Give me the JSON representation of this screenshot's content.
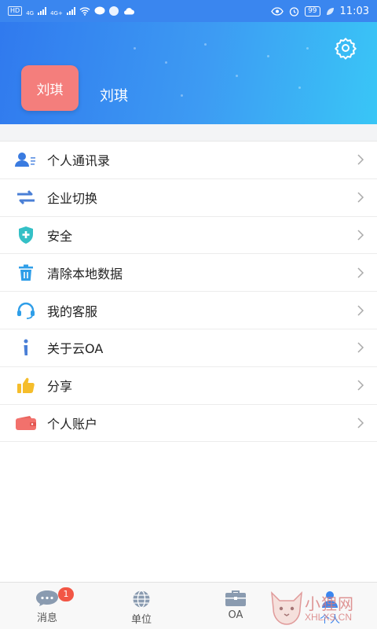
{
  "status_bar": {
    "carrier_chip": "HD",
    "net_1": "4G",
    "net_2": "4G+",
    "battery": "99",
    "time": "11:03"
  },
  "header": {
    "avatar_text": "刘琪",
    "user_name": "刘琪",
    "settings_icon": "gear-icon",
    "colors": {
      "gradient_start": "#3079ee",
      "gradient_end": "#39c6f6",
      "avatar_bg": "#f47e7c"
    }
  },
  "menu": {
    "items": [
      {
        "label": "个人通讯录",
        "icon": "contacts-icon"
      },
      {
        "label": "企业切换",
        "icon": "switch-arrows-icon"
      },
      {
        "label": "安全",
        "icon": "shield-icon"
      },
      {
        "label": "清除本地数据",
        "icon": "trash-icon"
      },
      {
        "label": "我的客服",
        "icon": "headset-icon"
      },
      {
        "label": "关于云OA",
        "icon": "info-icon"
      },
      {
        "label": "分享",
        "icon": "thumbs-up-icon"
      },
      {
        "label": "个人账户",
        "icon": "wallet-icon"
      }
    ]
  },
  "tabs": [
    {
      "label": "消息",
      "icon": "chat-icon",
      "badge": "1"
    },
    {
      "label": "单位",
      "icon": "globe-icon"
    },
    {
      "label": "OA",
      "icon": "briefcase-icon"
    },
    {
      "label": "个人",
      "icon": "person-icon",
      "active": true
    }
  ],
  "watermark": {
    "text": "小狸网",
    "url": "XHLXS.CN"
  }
}
